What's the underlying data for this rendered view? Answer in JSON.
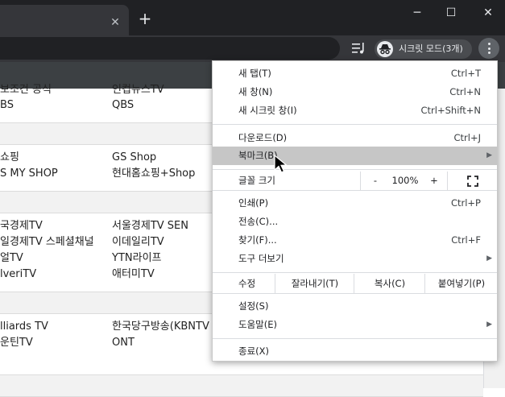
{
  "tabs": {
    "close_glyph": "✕",
    "new_tab_glyph": "+"
  },
  "window": {
    "minimize": "─",
    "maximize": "☐",
    "close": "✕"
  },
  "toolbar": {
    "incognito_label": "시크릿 모드(3개)"
  },
  "content": {
    "rows": [
      {
        "col1": "보조건 공식",
        "col2": "인컵뉴스TV"
      },
      {
        "col1": "BS",
        "col2": "QBS"
      },
      {
        "col1": "쇼핑",
        "col2": "GS Shop"
      },
      {
        "col1": "S MY SHOP",
        "col2": "현대홈쇼핑+Shop"
      },
      {
        "col1": "국경제TV",
        "col2": "서울경제TV SEN"
      },
      {
        "col1": "일경제TV 스페셜채널",
        "col2": "이데일리TV"
      },
      {
        "col1": "얼TV",
        "col2": "YTN라이프"
      },
      {
        "col1": "lveriTV",
        "col2": "애터미TV"
      },
      {
        "col1": "lliards TV",
        "col2": "한국당구방송(KBNTV"
      },
      {
        "col1": "운틴TV",
        "col2": "ONT"
      }
    ]
  },
  "menu": {
    "new_tab": {
      "label": "새 탭(T)",
      "shortcut": "Ctrl+T"
    },
    "new_window": {
      "label": "새 창(N)",
      "shortcut": "Ctrl+N"
    },
    "new_incognito": {
      "label": "새 시크릿 창(I)",
      "shortcut": "Ctrl+Shift+N"
    },
    "downloads": {
      "label": "다운로드(D)",
      "shortcut": "Ctrl+J"
    },
    "bookmarks": {
      "label": "북마크(B)"
    },
    "zoom": {
      "label": "글꼴 크기",
      "minus": "-",
      "value": "100%",
      "plus": "+"
    },
    "print": {
      "label": "인쇄(P)",
      "shortcut": "Ctrl+P"
    },
    "cast": {
      "label": "전송(C)..."
    },
    "find": {
      "label": "찾기(F)...",
      "shortcut": "Ctrl+F"
    },
    "more_tools": {
      "label": "도구 더보기"
    },
    "edit": {
      "label": "수정",
      "cut": "잘라내기(T)",
      "copy": "복사(C)",
      "paste": "붙여넣기(P)"
    },
    "settings": {
      "label": "설정(S)"
    },
    "help": {
      "label": "도움말(E)"
    },
    "exit": {
      "label": "종료(X)"
    }
  }
}
